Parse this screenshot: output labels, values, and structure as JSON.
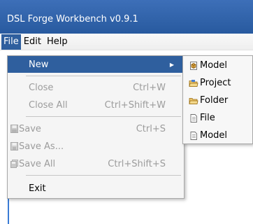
{
  "window": {
    "title": "DSL Forge Workbench v0.9.1"
  },
  "menubar": {
    "items": [
      "File",
      "Edit",
      "Help"
    ]
  },
  "file_menu": {
    "new": "New",
    "close": {
      "label": "Close",
      "accel": "Ctrl+W"
    },
    "close_all": {
      "label": "Close All",
      "accel": "Ctrl+Shift+W"
    },
    "save": {
      "label": "Save",
      "accel": "Ctrl+S"
    },
    "save_as": {
      "label": "Save As..."
    },
    "save_all": {
      "label": "Save All",
      "accel": "Ctrl+Shift+S"
    },
    "exit": "Exit"
  },
  "new_submenu": {
    "items": [
      {
        "label": "Model",
        "icon": "model-icon"
      },
      {
        "label": "Project",
        "icon": "project-folder-icon"
      },
      {
        "label": "Folder",
        "icon": "folder-icon"
      },
      {
        "label": "File",
        "icon": "file-icon"
      },
      {
        "label": "Model",
        "icon": "file-icon"
      }
    ]
  },
  "colors": {
    "titlebar": "#2f5f9e",
    "selection": "#2f5f9e",
    "disabled_text": "#9c9c9c",
    "menu_bg": "#f5f5f5"
  }
}
